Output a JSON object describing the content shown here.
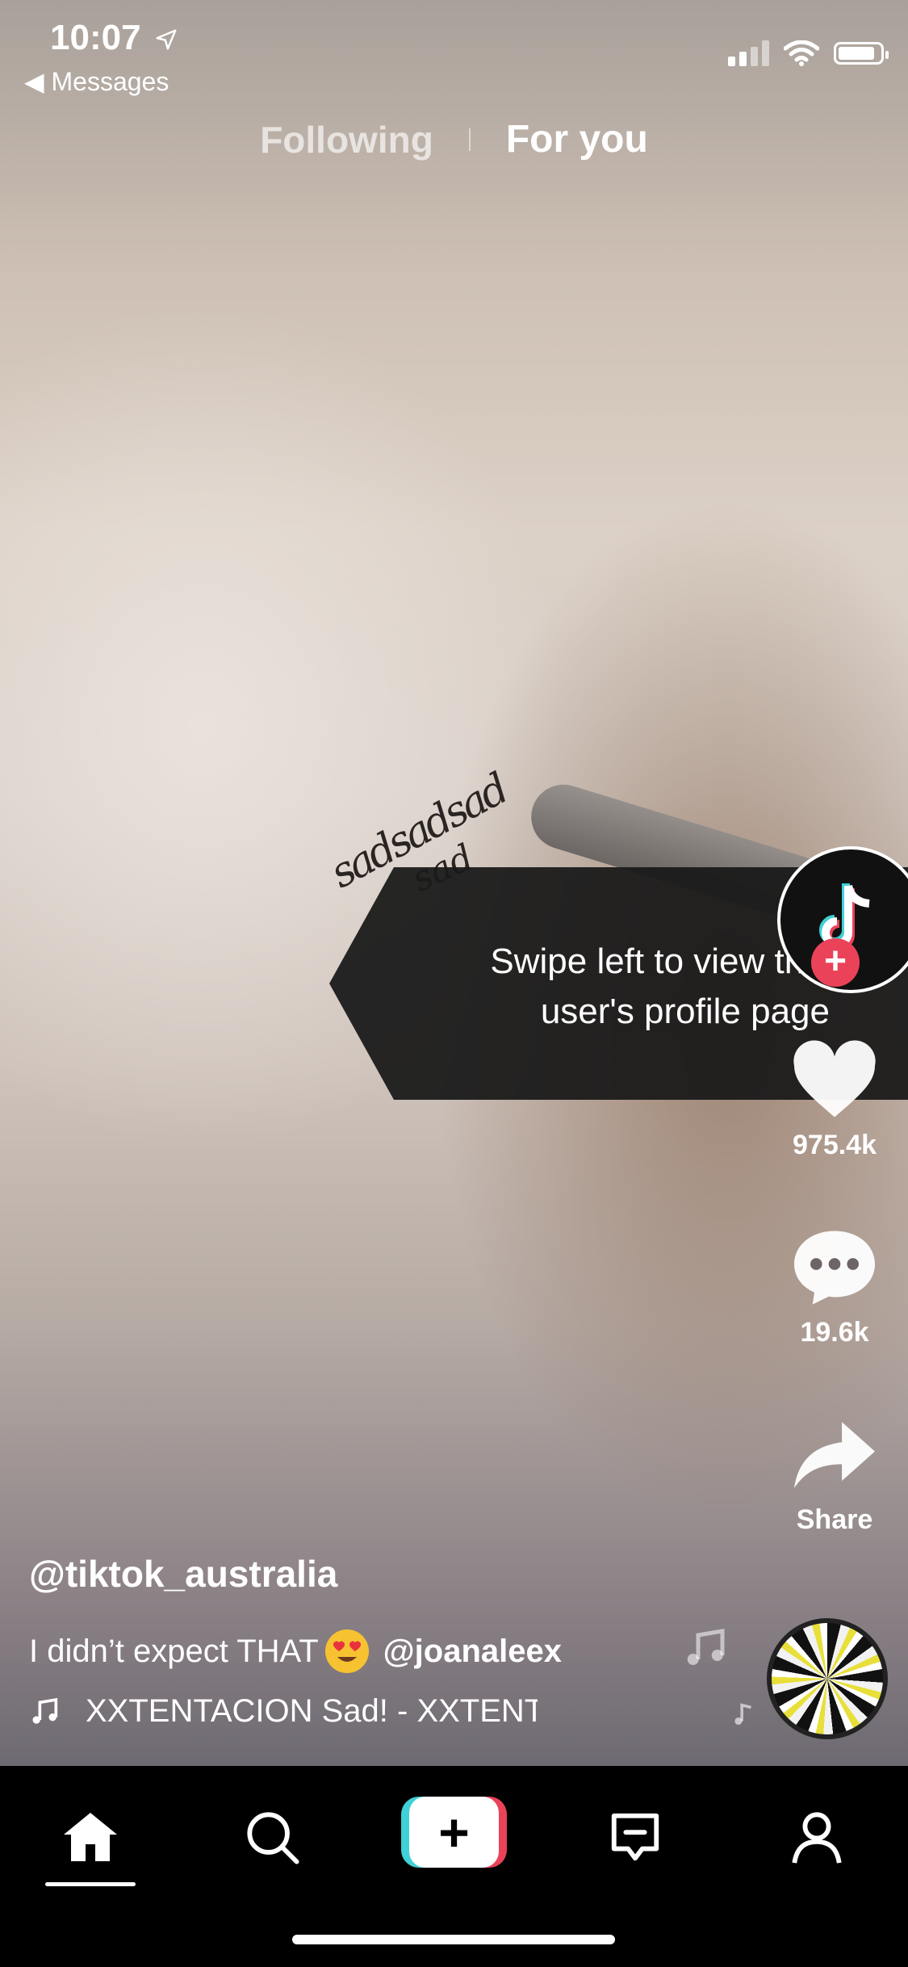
{
  "status_bar": {
    "time": "10:07",
    "back_label": "◀ Messages"
  },
  "feed_tabs": {
    "following": "Following",
    "for_you": "For you"
  },
  "video": {
    "handwriting_line1": "sadsadsad",
    "handwriting_line2": "sad"
  },
  "tooltip": {
    "text": "Swipe left to view this user's profile page"
  },
  "right_rail": {
    "likes_count": "975.4k",
    "comments_count": "19.6k",
    "share_label": "Share",
    "follow_symbol": "+"
  },
  "post": {
    "username": "@tiktok_australia",
    "caption_text": "I didn’t expect THAT",
    "caption_mention": "@joanaleex",
    "music_track": "XXTENTACION    Sad! - XXTENTACION"
  },
  "nav": {
    "create_symbol": "+"
  },
  "colors": {
    "accent_cyan": "#3fd1d6",
    "accent_red": "#ea4359"
  },
  "icons": [
    "location-arrow-icon",
    "signal-icon",
    "wifi-icon",
    "battery-icon",
    "tiktok-logo-icon",
    "heart-icon",
    "comment-icon",
    "share-icon",
    "music-note-icon",
    "home-icon",
    "search-icon",
    "create-icon",
    "inbox-icon",
    "profile-icon"
  ]
}
